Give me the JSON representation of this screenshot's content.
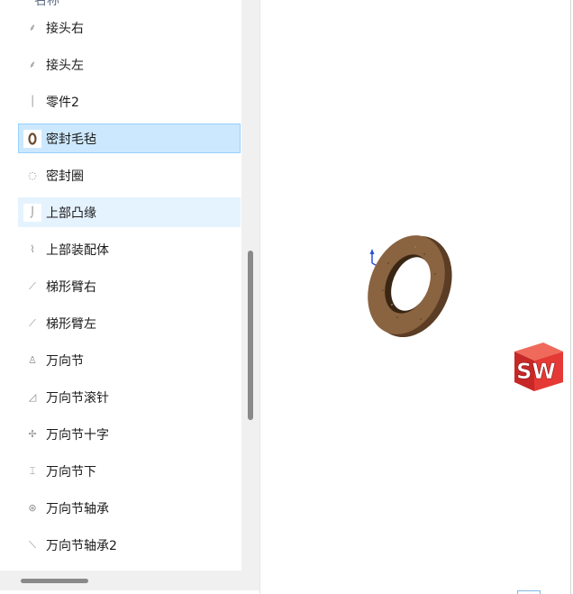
{
  "file_list": {
    "column_header": "名称",
    "items": [
      {
        "label": "接头右",
        "icon": "part-thumbnail-icon",
        "state": "normal"
      },
      {
        "label": "接头左",
        "icon": "part-thumbnail-icon",
        "state": "normal"
      },
      {
        "label": "零件2",
        "icon": "part-thumbnail-icon",
        "state": "normal"
      },
      {
        "label": "密封毛毡",
        "icon": "part-thumbnail-icon",
        "state": "selected"
      },
      {
        "label": "密封圈",
        "icon": "part-thumbnail-icon",
        "state": "normal"
      },
      {
        "label": "上部凸缘",
        "icon": "part-thumbnail-icon",
        "state": "hover"
      },
      {
        "label": "上部装配体",
        "icon": "assembly-thumbnail-icon",
        "state": "normal"
      },
      {
        "label": "梯形臂右",
        "icon": "part-thumbnail-icon",
        "state": "normal"
      },
      {
        "label": "梯形臂左",
        "icon": "part-thumbnail-icon",
        "state": "normal"
      },
      {
        "label": "万向节",
        "icon": "part-thumbnail-icon",
        "state": "normal"
      },
      {
        "label": "万向节滚针",
        "icon": "part-thumbnail-icon",
        "state": "normal"
      },
      {
        "label": "万向节十字",
        "icon": "part-thumbnail-icon",
        "state": "normal"
      },
      {
        "label": "万向节下",
        "icon": "part-thumbnail-icon",
        "state": "normal"
      },
      {
        "label": "万向节轴承",
        "icon": "part-thumbnail-icon",
        "state": "normal"
      },
      {
        "label": "万向节轴承2",
        "icon": "part-thumbnail-icon",
        "state": "normal"
      }
    ]
  },
  "preview": {
    "model_icon": "felt-seal-ring-3d-preview",
    "logo_icon": "solidworks-logo-icon",
    "logo_text": "SW"
  },
  "colors": {
    "selected_bg": "#cce8ff",
    "hover_bg": "#e5f3ff",
    "ring_brown": "#7a5535",
    "logo_red": "#d32f2f"
  }
}
